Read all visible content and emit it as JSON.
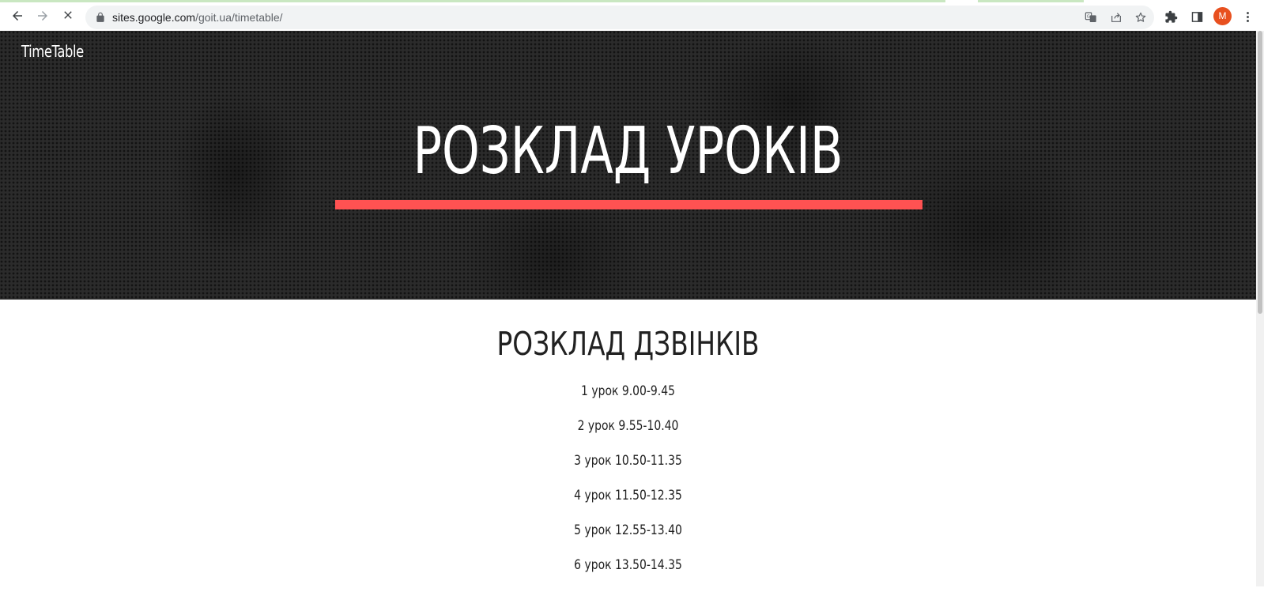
{
  "browser": {
    "url_host": "sites.google.com",
    "url_path": "/goit.ua/timetable/",
    "profile_initial": "M",
    "icons": [
      "back-icon",
      "forward-icon",
      "stop-icon",
      "lock-icon",
      "translate-icon",
      "share-icon",
      "star-icon",
      "extensions-icon",
      "side-panel-icon",
      "menu-icon"
    ]
  },
  "site": {
    "title": "TimeTable"
  },
  "hero": {
    "title": "РОЗКЛАД УРОКІВ",
    "accent_color": "#ff5252"
  },
  "main": {
    "section_title": "РОЗКЛАД ДЗВІНКІВ",
    "lessons": [
      "1 урок 9.00-9.45",
      "2 урок 9.55-10.40",
      "3 урок 10.50-11.35",
      "4 урок 11.50-12.35",
      "5 урок 12.55-13.40",
      "6 урок 13.50-14.35"
    ]
  }
}
